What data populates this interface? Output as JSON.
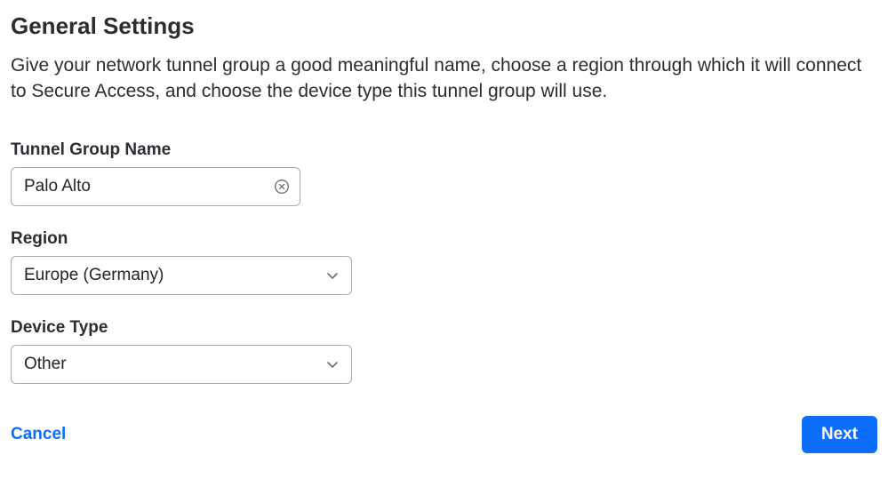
{
  "header": {
    "title": "General Settings",
    "description": "Give your network tunnel group a good meaningful name, choose a region through which it will connect to Secure Access, and choose the device type this tunnel group will use."
  },
  "form": {
    "tunnel_group_name": {
      "label": "Tunnel Group Name",
      "value": "Palo Alto"
    },
    "region": {
      "label": "Region",
      "value": "Europe (Germany)"
    },
    "device_type": {
      "label": "Device Type",
      "value": "Other"
    }
  },
  "footer": {
    "cancel_label": "Cancel",
    "next_label": "Next"
  }
}
